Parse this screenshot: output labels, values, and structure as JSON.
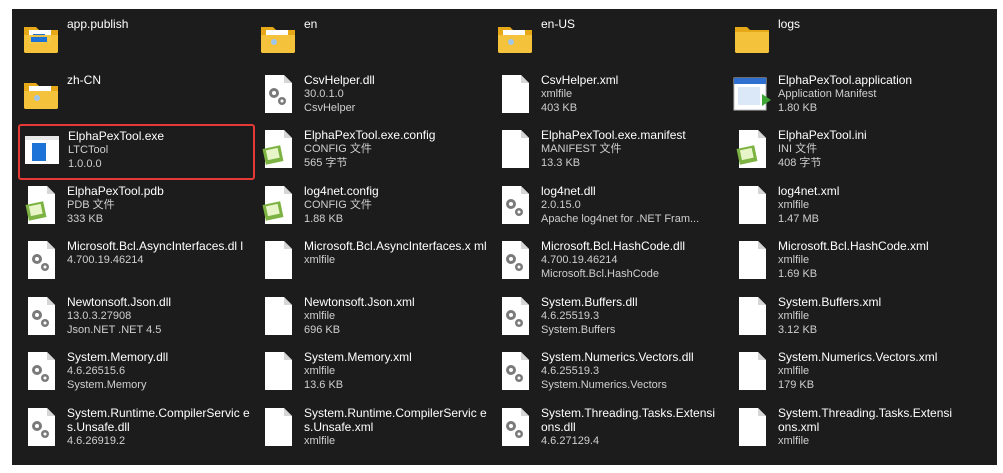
{
  "files": [
    {
      "name": "app.publish",
      "meta": [],
      "icon": "folder-with-window-icon"
    },
    {
      "name": "en",
      "meta": [],
      "icon": "folder-with-globe-icon"
    },
    {
      "name": "en-US",
      "meta": [],
      "icon": "folder-with-globe-icon"
    },
    {
      "name": "logs",
      "meta": [],
      "icon": "folder-icon"
    },
    {
      "name": "zh-CN",
      "meta": [],
      "icon": "folder-with-globe-icon"
    },
    {
      "name": "CsvHelper.dll",
      "meta": [
        "30.0.1.0",
        "CsvHelper"
      ],
      "icon": "dll-gear-icon"
    },
    {
      "name": "CsvHelper.xml",
      "meta": [
        "xmlfile",
        "403 KB"
      ],
      "icon": "blank-file-icon"
    },
    {
      "name": "ElphaPexTool.application",
      "meta": [
        "Application Manifest",
        "1.80 KB"
      ],
      "icon": "application-manifest-icon"
    },
    {
      "name": "ElphaPexTool.exe",
      "meta": [
        "LTCTool",
        "1.0.0.0"
      ],
      "icon": "exe-window-icon",
      "selected": true
    },
    {
      "name": "ElphaPexTool.exe.config",
      "meta": [
        "CONFIG 文件",
        "565 字节"
      ],
      "icon": "notepad-file-icon"
    },
    {
      "name": "ElphaPexTool.exe.manifest",
      "meta": [
        "MANIFEST 文件",
        "13.3 KB"
      ],
      "icon": "blank-file-icon"
    },
    {
      "name": "ElphaPexTool.ini",
      "meta": [
        "INI 文件",
        "408 字节"
      ],
      "icon": "notepad-file-icon"
    },
    {
      "name": "ElphaPexTool.pdb",
      "meta": [
        "PDB 文件",
        "333 KB"
      ],
      "icon": "notepad-file-icon"
    },
    {
      "name": "log4net.config",
      "meta": [
        "CONFIG 文件",
        "1.88 KB"
      ],
      "icon": "notepad-file-icon"
    },
    {
      "name": "log4net.dll",
      "meta": [
        "2.0.15.0",
        "Apache log4net for .NET Fram..."
      ],
      "icon": "dll-gear-icon"
    },
    {
      "name": "log4net.xml",
      "meta": [
        "xmlfile",
        "1.47 MB"
      ],
      "icon": "blank-file-icon"
    },
    {
      "name": "Microsoft.Bcl.AsyncInterfaces.dl l",
      "meta": [
        "4.700.19.46214"
      ],
      "icon": "dll-gear-icon"
    },
    {
      "name": "Microsoft.Bcl.AsyncInterfaces.x ml",
      "meta": [
        "xmlfile"
      ],
      "icon": "blank-file-icon"
    },
    {
      "name": "Microsoft.Bcl.HashCode.dll",
      "meta": [
        "4.700.19.46214",
        "Microsoft.Bcl.HashCode"
      ],
      "icon": "dll-gear-icon"
    },
    {
      "name": "Microsoft.Bcl.HashCode.xml",
      "meta": [
        "xmlfile",
        "1.69 KB"
      ],
      "icon": "blank-file-icon"
    },
    {
      "name": "Newtonsoft.Json.dll",
      "meta": [
        "13.0.3.27908",
        "Json.NET .NET 4.5"
      ],
      "icon": "dll-gear-icon"
    },
    {
      "name": "Newtonsoft.Json.xml",
      "meta": [
        "xmlfile",
        "696 KB"
      ],
      "icon": "blank-file-icon"
    },
    {
      "name": "System.Buffers.dll",
      "meta": [
        "4.6.25519.3",
        "System.Buffers"
      ],
      "icon": "dll-gear-icon"
    },
    {
      "name": "System.Buffers.xml",
      "meta": [
        "xmlfile",
        "3.12 KB"
      ],
      "icon": "blank-file-icon"
    },
    {
      "name": "System.Memory.dll",
      "meta": [
        "4.6.26515.6",
        "System.Memory"
      ],
      "icon": "dll-gear-icon"
    },
    {
      "name": "System.Memory.xml",
      "meta": [
        "xmlfile",
        "13.6 KB"
      ],
      "icon": "blank-file-icon"
    },
    {
      "name": "System.Numerics.Vectors.dll",
      "meta": [
        "4.6.25519.3",
        "System.Numerics.Vectors"
      ],
      "icon": "dll-gear-icon"
    },
    {
      "name": "System.Numerics.Vectors.xml",
      "meta": [
        "xmlfile",
        "179 KB"
      ],
      "icon": "blank-file-icon"
    },
    {
      "name": "System.Runtime.CompilerServic es.Unsafe.dll",
      "meta": [
        "4.6.26919.2"
      ],
      "icon": "dll-gear-icon"
    },
    {
      "name": "System.Runtime.CompilerServic es.Unsafe.xml",
      "meta": [
        "xmlfile"
      ],
      "icon": "blank-file-icon"
    },
    {
      "name": "System.Threading.Tasks.Extensi ons.dll",
      "meta": [
        "4.6.27129.4"
      ],
      "icon": "dll-gear-icon"
    },
    {
      "name": "System.Threading.Tasks.Extensi ons.xml",
      "meta": [
        "xmlfile"
      ],
      "icon": "blank-file-icon"
    }
  ],
  "colors": {
    "background": "#1c1c1c",
    "selection_border": "#e53935",
    "folder": "#f5c33b",
    "text": "#ffffff",
    "meta_text": "#cfcfcf"
  }
}
